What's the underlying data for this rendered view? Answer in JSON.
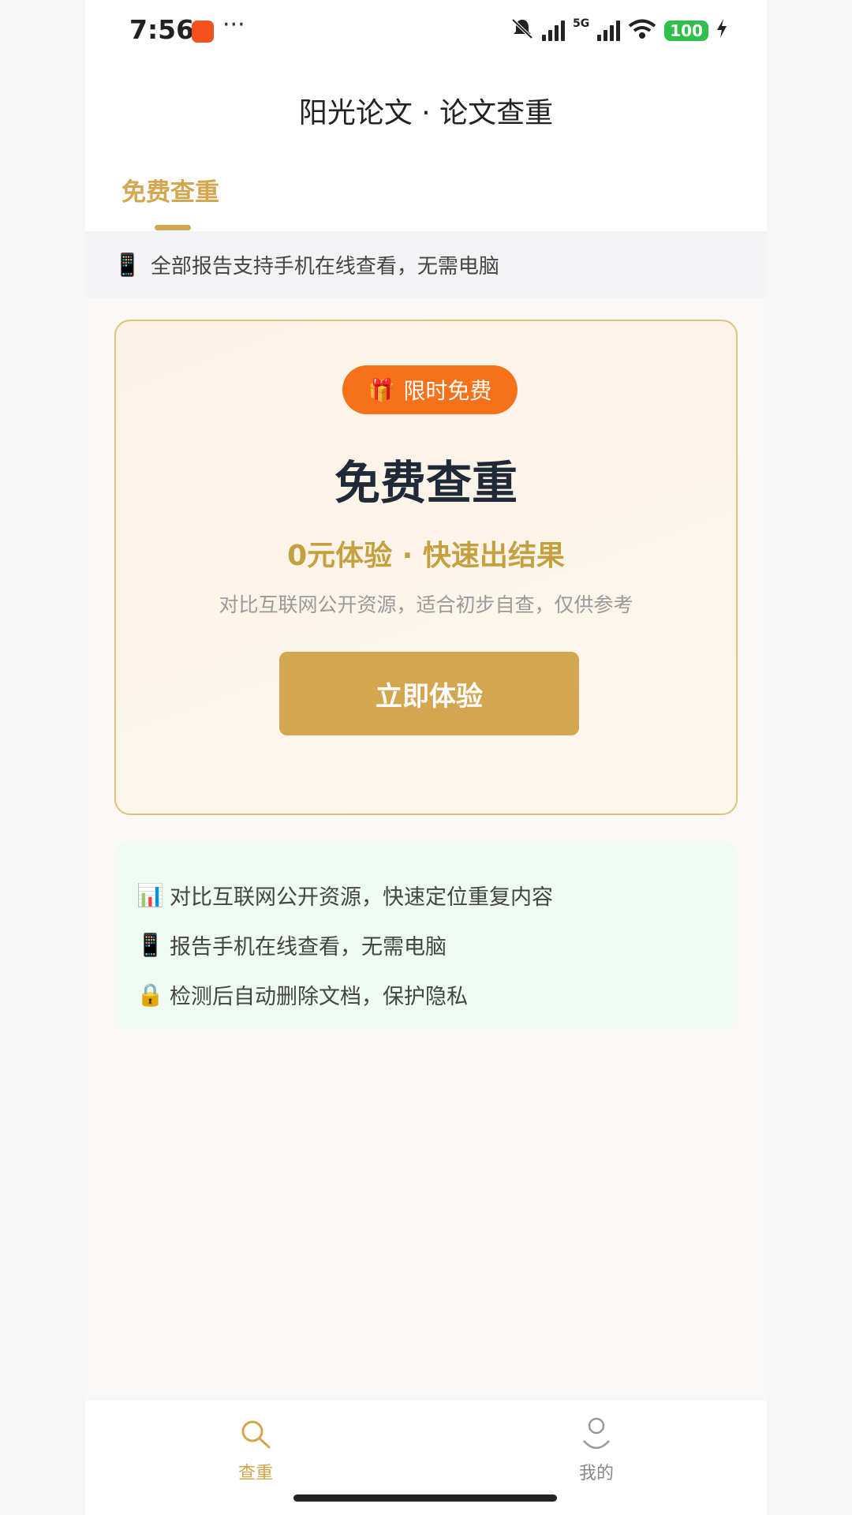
{
  "status_bar": {
    "time": "7:56",
    "more": "···",
    "network_5g": "5G",
    "battery": "100"
  },
  "header": {
    "title": "阳光论文 · 论文查重"
  },
  "tabs": [
    {
      "label": "免费查重",
      "active": true
    }
  ],
  "notice": {
    "icon": "📱",
    "text": "全部报告支持手机在线查看，无需电脑"
  },
  "promo": {
    "badge_icon": "🎁",
    "badge_label": "限时免费",
    "title": "免费查重",
    "subtitle": "0元体验 · 快速出结果",
    "description": "对比互联网公开资源，适合初步自查，仅供参考",
    "cta_label": "立即体验"
  },
  "features": [
    {
      "icon": "📊",
      "text": "对比互联网公开资源，快速定位重复内容"
    },
    {
      "icon": "📱",
      "text": "报告手机在线查看，无需电脑"
    },
    {
      "icon": "🔒",
      "text": "检测后自动删除文档，保护隐私"
    }
  ],
  "bottom_nav": [
    {
      "label": "查重",
      "icon": "search-icon",
      "active": true
    },
    {
      "label": "我的",
      "icon": "user-icon",
      "active": false
    }
  ],
  "colors": {
    "accent": "#d3a64f",
    "badge": "#f7711a",
    "feature_bg": "#eefaf2",
    "title_dark": "#1f2937"
  }
}
